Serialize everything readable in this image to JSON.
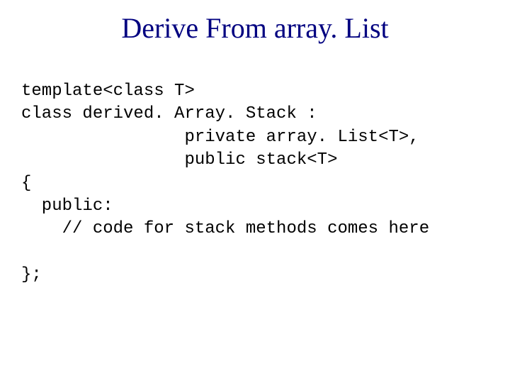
{
  "title": "Derive From array. List",
  "code": {
    "l1": "template<class T>",
    "l2": "class derived. Array. Stack :",
    "l3": "                private array. List<T>,",
    "l4": "                public stack<T>",
    "l5": "{",
    "l6": "  public:",
    "l7": "    // code for stack methods comes here",
    "l8": "",
    "l9": "};"
  }
}
